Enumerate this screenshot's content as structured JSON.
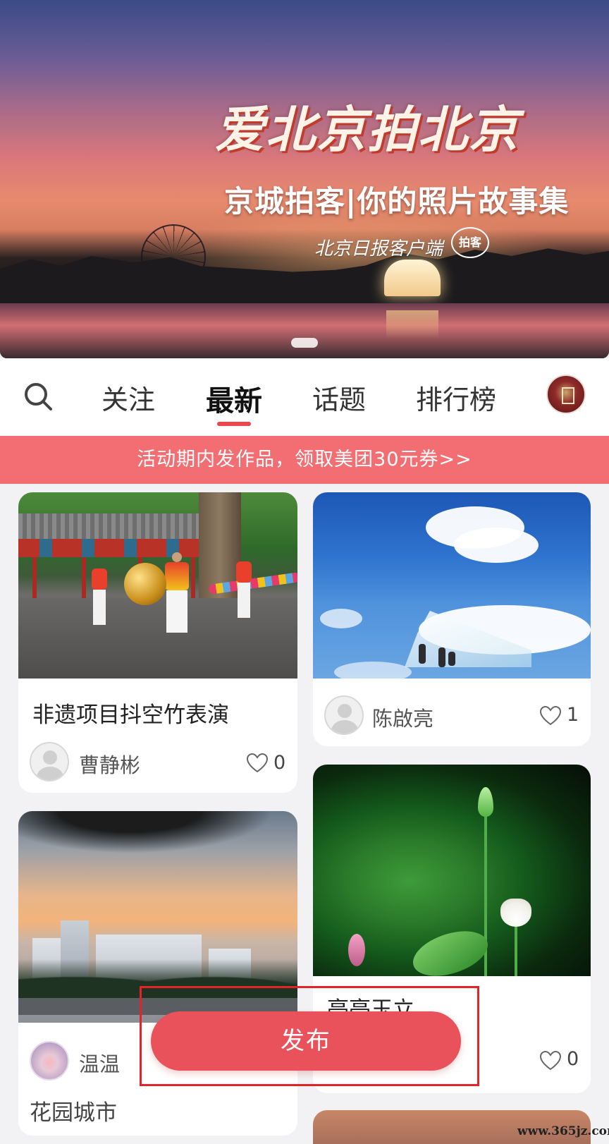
{
  "banner": {
    "title": "爱北京拍北京",
    "subtitle": "京城拍客|你的照片故事集",
    "brand": "北京日报客户端",
    "brand_logo_text": "拍客"
  },
  "tabs": [
    {
      "label": "关注",
      "active": false
    },
    {
      "label": "最新",
      "active": true
    },
    {
      "label": "话题",
      "active": false
    },
    {
      "label": "排行榜",
      "active": false
    }
  ],
  "promo": {
    "text": "活动期内发作品，领取美团30元券>>"
  },
  "feed": {
    "cards": [
      {
        "title": "非遗项目抖空竹表演",
        "user": "曹静彬",
        "likes": "0"
      },
      {
        "title": "",
        "user": "陈啟亮",
        "likes": "1"
      },
      {
        "title": "花园城市",
        "user": "温温",
        "likes": ""
      },
      {
        "title": "亭亭玉立",
        "user": "",
        "likes": "0"
      }
    ]
  },
  "publish": {
    "label": "发布"
  },
  "watermark": "www.365jz.com",
  "colors": {
    "accent": "#e9525a",
    "promo_bg": "#f36e72",
    "tab_underline": "#e8484e"
  }
}
